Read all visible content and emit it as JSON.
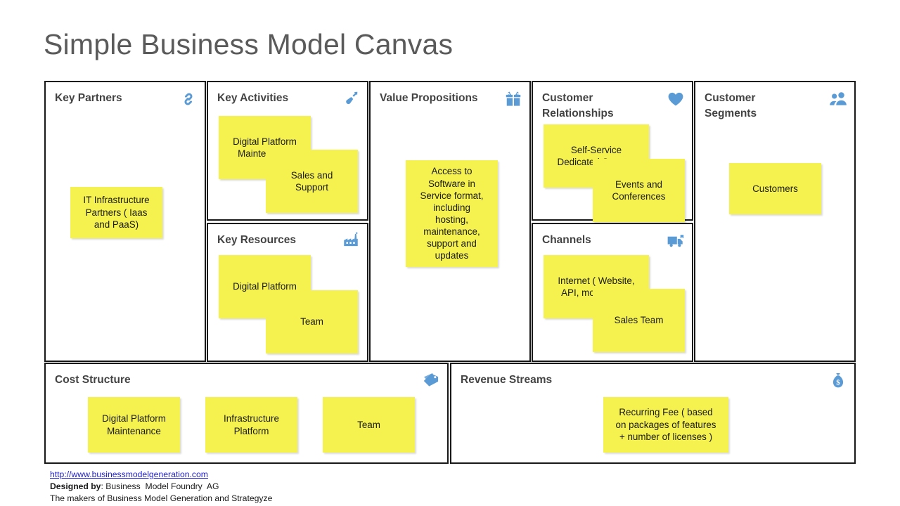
{
  "title": "Simple Business Model Canvas",
  "colors": {
    "note": "#F5F24F",
    "icon": "#5B9BD5",
    "border": "#181818",
    "title_text": "#5A5A5A",
    "heading_text": "#434343",
    "link": "#2222CC"
  },
  "blocks": {
    "key_partners": {
      "title": "Key Partners",
      "icon": "chain-link-icon",
      "notes": [
        {
          "text": "IT Infrastructure\nPartners ( Iaas\nand PaaS)"
        }
      ]
    },
    "key_activities": {
      "title": "Key Activities",
      "icon": "shovel-icon",
      "notes": [
        {
          "text": "Digital Platform\nMaintenance"
        },
        {
          "text": "Sales and\nSupport"
        }
      ]
    },
    "key_resources": {
      "title": "Key Resources",
      "icon": "factory-icon",
      "notes": [
        {
          "text": "Digital Platform"
        },
        {
          "text": "Team"
        }
      ]
    },
    "value_propositions": {
      "title": "Value Propositions",
      "icon": "gift-icon",
      "notes": [
        {
          "text": "Access to\nSoftware in\nService format,\nincluding\nhosting,\nmaintenance,\nsupport and\nupdates"
        }
      ]
    },
    "customer_relationships": {
      "title": "Customer Relationships",
      "icon": "heart-icon",
      "notes": [
        {
          "text": "Self-Service\nDedicated Support"
        },
        {
          "text": "Events and\nConferences"
        }
      ]
    },
    "channels": {
      "title": "Channels",
      "icon": "delivery-truck-icon",
      "notes": [
        {
          "text": "Internet ( Website,\nAPI, mobile App)"
        },
        {
          "text": "Sales Team"
        }
      ]
    },
    "customer_segments": {
      "title": "Customer Segments",
      "icon": "two-people-icon",
      "notes": [
        {
          "text": "Customers"
        }
      ]
    },
    "cost_structure": {
      "title": "Cost Structure",
      "icon": "price-tag-icon",
      "notes": [
        {
          "text": "Digital Platform\nMaintenance"
        },
        {
          "text": "Infrastructure\nPlatform"
        },
        {
          "text": "Team"
        }
      ]
    },
    "revenue_streams": {
      "title": "Revenue Streams",
      "icon": "money-bag-icon",
      "notes": [
        {
          "text": "Recurring Fee ( based\non packages of features\n+ number of licenses )"
        }
      ]
    }
  },
  "footer": {
    "url": "http://www.businessmodelgeneration.com",
    "designed_by_label": "Designed by",
    "designed_by_value": ": Business  Model Foundry  AG",
    "makers_line": "The makers of Business Model Generation and Strategyze"
  }
}
